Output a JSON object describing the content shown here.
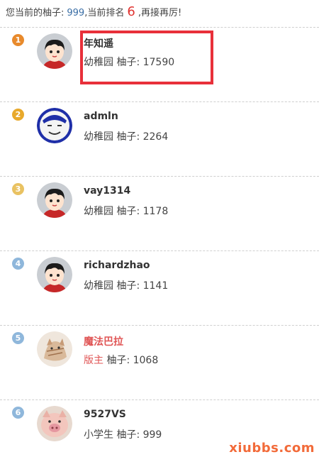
{
  "header": {
    "prefix": "您当前的柚子:",
    "score": "999",
    "middle": ",当前排名",
    "rank": "6",
    "suffix": ",再接再厉!"
  },
  "colors": {
    "rank_orange": "#e88a2c",
    "rank_gold": "#e8a92c",
    "rank_yellow": "#e9c262",
    "rank_blue": "#8fb7db",
    "highlight": "#e8303a",
    "moderator_red": "#e05555"
  },
  "rows": [
    {
      "rank": "1",
      "name": "年知遥",
      "grade": "幼稚园",
      "points": "柚子: 17590",
      "avatar": "cartoon-boy-avatar"
    },
    {
      "rank": "2",
      "name": "admln",
      "grade": "幼稚园",
      "points": "柚子: 2264",
      "avatar": "meme-face-avatar"
    },
    {
      "rank": "3",
      "name": "vay1314",
      "grade": "幼稚园",
      "points": "柚子: 1178",
      "avatar": "cartoon-boy-avatar"
    },
    {
      "rank": "4",
      "name": "richardzhao",
      "grade": "幼稚园",
      "points": "柚子: 1141",
      "avatar": "cartoon-boy-avatar"
    },
    {
      "rank": "5",
      "name": "魔法巴拉",
      "grade": "版主",
      "points": "柚子: 1068",
      "avatar": "cat-avatar"
    },
    {
      "rank": "6",
      "name": "9527VS",
      "grade": "小学生",
      "points": "柚子: 999",
      "avatar": "pig-avatar"
    }
  ],
  "watermark": "xiubbs.com"
}
